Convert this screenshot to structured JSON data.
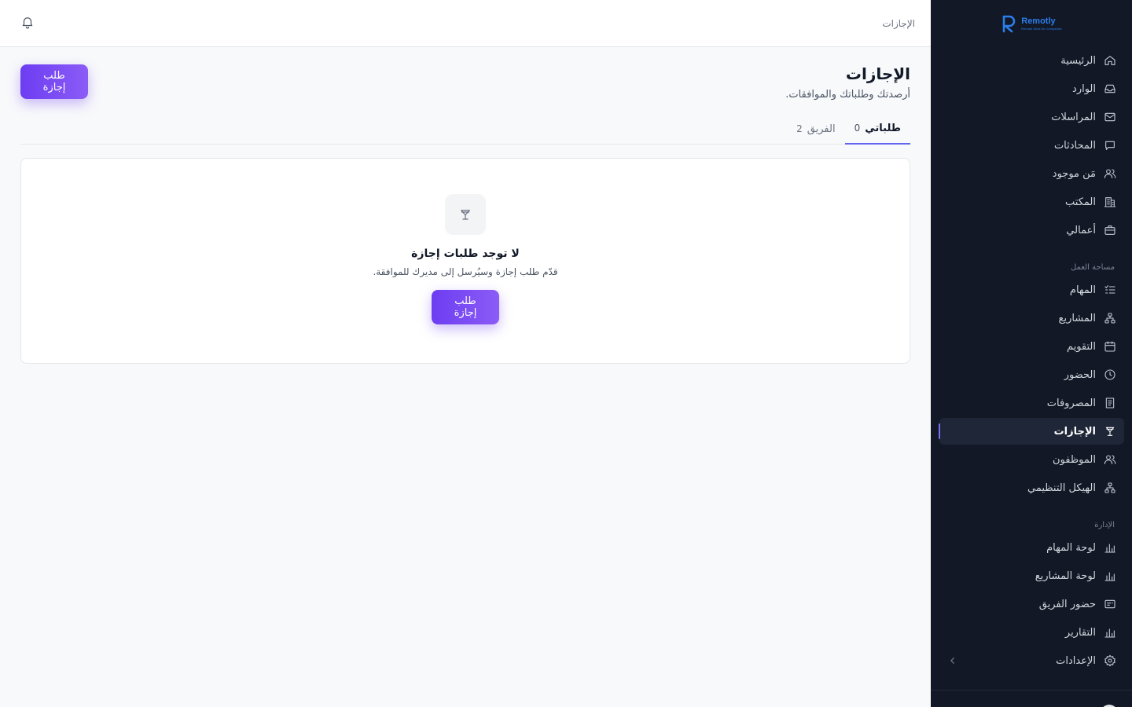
{
  "brand": {
    "name": "Remotly",
    "tagline": "Remote Work for Companies",
    "color": "#2b7de9"
  },
  "topbar": {
    "breadcrumb": "الإجازات",
    "bell_icon": "bell-icon"
  },
  "page": {
    "title": "الإجازات",
    "subtitle": "أرصدتك وطلباتك والموافقات.",
    "request_button": "طلب إجازة"
  },
  "tabs": [
    {
      "label": "طلباتي",
      "count": "0",
      "active": true
    },
    {
      "label": "الفريق",
      "count": "2",
      "active": false
    }
  ],
  "empty_state": {
    "title": "لا توجد طلبات إجازة",
    "description": "قدّم طلب إجازة وسيُرسل إلى مديرك للموافقة.",
    "button": "طلب إجازة",
    "icon": "cocktail-icon"
  },
  "sidebar": {
    "main_items": [
      {
        "label": "الرئيسية",
        "icon": "home-icon"
      },
      {
        "label": "الوارد",
        "icon": "inbox-icon"
      },
      {
        "label": "المراسلات",
        "icon": "mail-icon"
      },
      {
        "label": "المحادثات",
        "icon": "chat-icon"
      },
      {
        "label": "مَن موجود",
        "icon": "users-icon"
      },
      {
        "label": "المكتب",
        "icon": "building-icon"
      },
      {
        "label": "أعمالي",
        "icon": "briefcase-icon"
      }
    ],
    "workspace_label": "مساحة العمل",
    "workspace_items": [
      {
        "label": "المهام",
        "icon": "tasks-icon"
      },
      {
        "label": "المشاريع",
        "icon": "network-icon"
      },
      {
        "label": "التقويم",
        "icon": "calendar-icon"
      },
      {
        "label": "الحضور",
        "icon": "clock-icon"
      },
      {
        "label": "المصروفات",
        "icon": "receipt-icon"
      },
      {
        "label": "الإجازات",
        "icon": "cocktail-icon",
        "active": true
      },
      {
        "label": "الموظفون",
        "icon": "users-icon"
      },
      {
        "label": "الهيكل التنظيمي",
        "icon": "org-chart-icon"
      }
    ],
    "admin_label": "الإدارة",
    "admin_items": [
      {
        "label": "لوحة المهام",
        "icon": "bar-chart-icon"
      },
      {
        "label": "لوحة المشاريع",
        "icon": "bar-chart-icon"
      },
      {
        "label": "حضور الفريق",
        "icon": "id-card-icon"
      },
      {
        "label": "التقارير",
        "icon": "bar-chart-icon"
      },
      {
        "label": "الإعدادات",
        "icon": "gear-icon"
      }
    ]
  },
  "colors": {
    "sidebar_bg": "#121826",
    "active_item_bg": "#1f2637",
    "accent": "#6d3df2",
    "tab_underline": "#6366f1"
  }
}
